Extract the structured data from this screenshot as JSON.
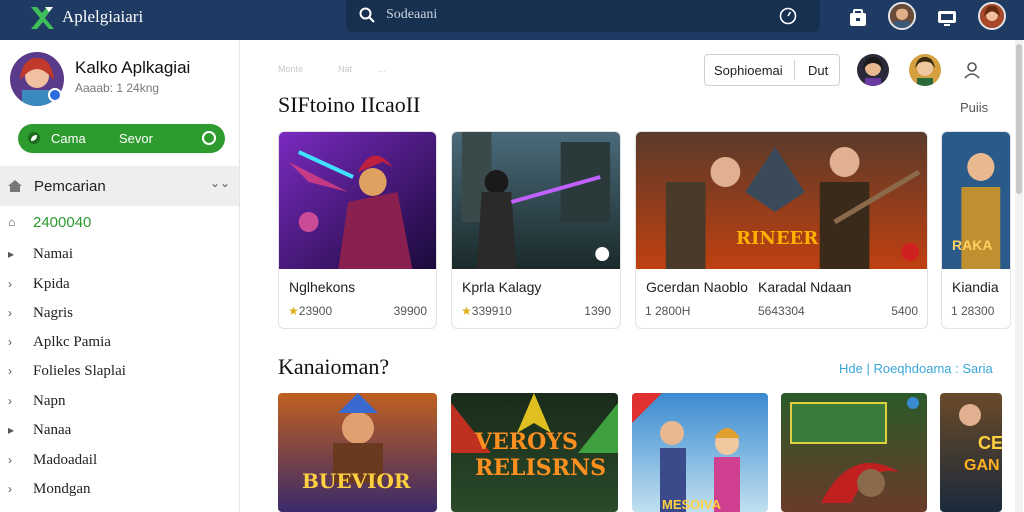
{
  "topbar": {
    "app_title": "Aplelgiaiari",
    "search_placeholder": "Sodeaani",
    "colors": {
      "bg": "#1f3a63",
      "search": "#17304f"
    }
  },
  "sidebar": {
    "profile": {
      "name": "Kalko Aplkagiai",
      "subtitle": "Aaaab: 1 24kng"
    },
    "cta": {
      "left_label": "Cama",
      "right_label": "Sevor"
    },
    "active_item": {
      "label": "Pemcarian"
    },
    "items": [
      {
        "label": "2400040",
        "highlight": true
      },
      {
        "label": "Namai"
      },
      {
        "label": "Kpida"
      },
      {
        "label": "Nagris"
      },
      {
        "label": "Aplkc Pamia"
      },
      {
        "label": "Folieles Slaplai"
      },
      {
        "label": "Napn"
      },
      {
        "label": "Nanaa"
      },
      {
        "label": "Madoadail"
      },
      {
        "label": "Mondgan"
      }
    ]
  },
  "main": {
    "faint": [
      "Monte",
      "Nat",
      "..."
    ],
    "segment": {
      "left": "Sophioemai",
      "right": "Dut"
    },
    "section1": {
      "title": "SIFtoino IIcaoII",
      "link": "Puiis",
      "cards": [
        {
          "title": "Nglhekons",
          "rating": "23900",
          "downloads": "39900"
        },
        {
          "title": "Kprla Kalagy",
          "rating": "339910",
          "downloads": "1390"
        },
        {
          "title": "Gcerdan Naoblo",
          "title2": "Karadal Ndaan",
          "rating": "1 2800H",
          "mid": "5643304",
          "downloads": "5400"
        },
        {
          "title": "Kiandia",
          "rating": "1 28300",
          "downloads": ""
        }
      ],
      "art_labels": [
        "RINEER",
        "RAKA"
      ]
    },
    "section2": {
      "title": "Kanaioman?",
      "link": "Hde | Roeqhdoama  :  Saria",
      "tile_labels": [
        "BUEVIOR",
        "VEROYS",
        "RELISRNS",
        "MESOIVA",
        "CE",
        "GAN"
      ]
    },
    "colors": {
      "accent_green": "#2e9b2e",
      "link_blue": "#3aa7d8"
    }
  }
}
